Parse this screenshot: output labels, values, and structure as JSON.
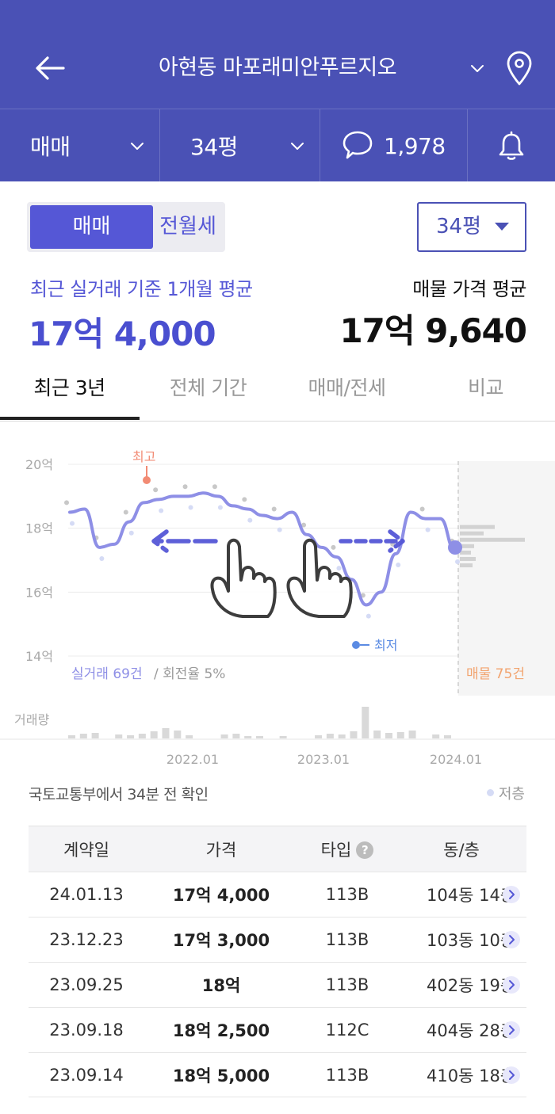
{
  "header": {
    "title": "아현동 마포래미안푸르지오",
    "icons": [
      "back-arrow-icon",
      "chevron-down-icon",
      "location-pin-icon"
    ]
  },
  "subbar": {
    "trade_type": "매매",
    "area": "34평",
    "comment_count": "1,978",
    "icons": [
      "chevron-down-icon",
      "speech-bubble-icon",
      "bell-icon"
    ]
  },
  "toggle": {
    "active": "매매",
    "inactive": "전월세"
  },
  "area_select": "34평",
  "summary": {
    "left_label": "최근 실거래 기준 1개월 평균",
    "left_value": "17억 4,000",
    "right_label": "매물 가격 평균",
    "right_value": "17억 9,640"
  },
  "tabs": [
    "최근 3년",
    "전체 기간",
    "매매/전세",
    "비교"
  ],
  "chart_data": {
    "type": "line",
    "y_ticks": [
      "20억",
      "18억",
      "16억",
      "14억"
    ],
    "ylim": [
      14,
      20
    ],
    "x_ticks": [
      "2022.01",
      "2023.01",
      "2024.01"
    ],
    "high_label": "최고",
    "low_label": "최저",
    "trade_summary": "실거래 69건",
    "turnover": "/ 회전율 5%",
    "listing_summary": "매물 75건",
    "volume_label": "거래량",
    "series": [
      {
        "values": [
          18.5,
          18.6,
          17.4,
          17.5,
          18.2,
          18.8,
          18.9,
          19.0,
          19.0,
          19.1,
          19.0,
          18.7,
          18.6,
          18.4,
          18.3,
          18.5,
          17.8,
          17.4,
          17.1,
          16.4,
          15.6,
          16.0,
          17.2,
          18.5,
          18.3,
          18.3,
          17.3
        ],
        "color": "#8e8fe6"
      }
    ],
    "highlight_colors": {
      "high": "#f28b74",
      "low": "#5b8be3",
      "line": "#8e8fe6"
    }
  },
  "fetch_note": "국토교통부에서 34분 전 확인",
  "legend_low_floor": "저층",
  "table": {
    "headers": [
      "계약일",
      "가격",
      "타입",
      "동/층"
    ],
    "rows": [
      {
        "date": "24.01.13",
        "price": "17억 4,000",
        "type": "113B",
        "floor": "104동 14층"
      },
      {
        "date": "23.12.23",
        "price": "17억 3,000",
        "type": "113B",
        "floor": "103동 10층"
      },
      {
        "date": "23.09.25",
        "price": "18억",
        "type": "113B",
        "floor": "402동 19층"
      },
      {
        "date": "23.09.18",
        "price": "18억 2,500",
        "type": "112C",
        "floor": "404동 28층"
      },
      {
        "date": "23.09.14",
        "price": "18억 5,000",
        "type": "113B",
        "floor": "410동 18층"
      }
    ]
  }
}
